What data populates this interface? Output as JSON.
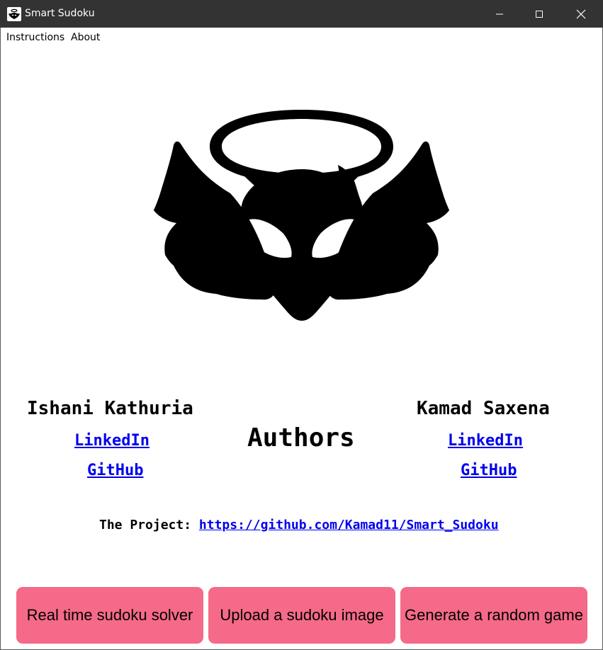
{
  "window": {
    "title": "Smart Sudoku",
    "app_icon": "owl-mask-icon",
    "controls": [
      "minimize-icon",
      "maximize-icon",
      "close-icon"
    ]
  },
  "menu": {
    "instructions": "Instructions",
    "about": "About"
  },
  "logo": {
    "icon": "haloed-winged-mask-logo",
    "color": "#000000"
  },
  "authors": {
    "heading": "Authors",
    "left": {
      "name": "Ishani Kathuria",
      "linkedin": "LinkedIn",
      "github": "GitHub"
    },
    "right": {
      "name": "Kamad Saxena",
      "linkedin": "LinkedIn",
      "github": "GitHub"
    }
  },
  "project": {
    "label": "The Project:",
    "url": "https://github.com/Kamad11/Smart_Sudoku"
  },
  "buttons": {
    "realtime": "Real time sudoku solver",
    "upload": "Upload a sudoku image",
    "random": "Generate a random game"
  },
  "colors": {
    "titlebar": "#333333",
    "button": "#f56a88",
    "link": "#0000ee"
  }
}
